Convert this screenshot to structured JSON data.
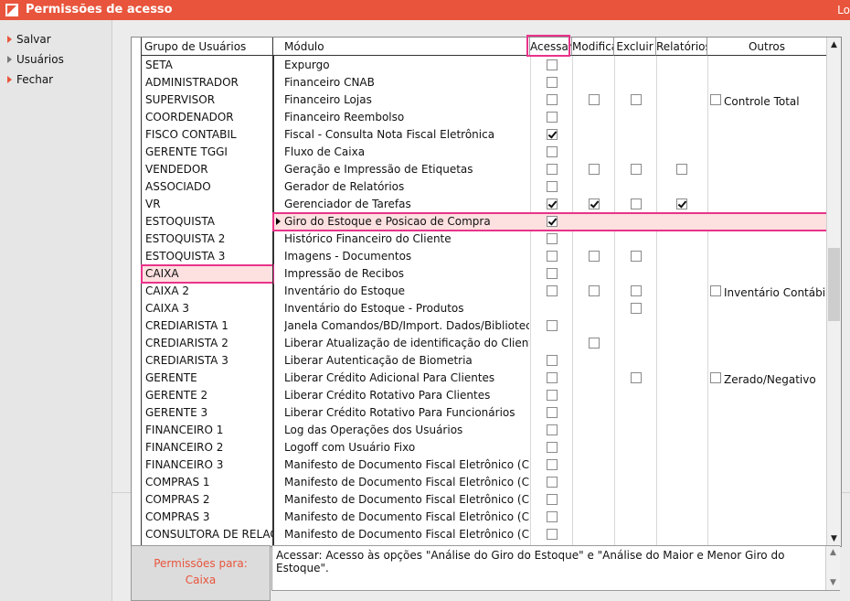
{
  "window": {
    "title": "Permissões de acesso",
    "right_text": "Lo"
  },
  "menu": [
    {
      "label": "Salvar",
      "icon": "arrow-right-icon"
    },
    {
      "label": "Usuários",
      "icon": "arrow-right-icon"
    },
    {
      "label": "Fechar",
      "icon": "arrow-right-icon"
    }
  ],
  "groups": {
    "header": "Grupo de Usuários",
    "selected": "CAIXA",
    "items": [
      "SETA",
      "ADMINISTRADOR",
      "SUPERVISOR",
      "COORDENADOR",
      "FISCO CONTABIL",
      "GERENTE TGGI",
      "VENDEDOR",
      "ASSOCIADO",
      "VR",
      "ESTOQUISTA",
      "ESTOQUISTA 2",
      "ESTOQUISTA 3",
      "CAIXA",
      "CAIXA 2",
      "CAIXA 3",
      "CREDIARISTA 1",
      "CREDIARISTA 2",
      "CREDIARISTA 3",
      "GERENTE",
      "GERENTE 2",
      "GERENTE 3",
      "FINANCEIRO 1",
      "FINANCEIRO 2",
      "FINANCEIRO 3",
      "COMPRAS 1",
      "COMPRAS 2",
      "COMPRAS 3",
      "CONSULTORA DE RELACIONAMENTO"
    ]
  },
  "modules": {
    "headers": [
      "Módulo",
      "Acessar",
      "Modifica",
      "Excluir",
      "Relatórios",
      "Outros"
    ],
    "selected_index": 9,
    "rows": [
      {
        "name": "Expurgo",
        "acessar": false
      },
      {
        "name": "Financeiro CNAB",
        "acessar": false
      },
      {
        "name": "Financeiro Lojas",
        "acessar": false,
        "modifica": false,
        "excluir": false,
        "other_label": "Controle Total",
        "other": false
      },
      {
        "name": "Financeiro Reembolso",
        "acessar": false
      },
      {
        "name": "Fiscal - Consulta Nota Fiscal Eletrônica",
        "acessar": true
      },
      {
        "name": "Fluxo de Caixa",
        "acessar": false
      },
      {
        "name": "Geração e Impressão de Etiquetas",
        "acessar": false,
        "modifica": false,
        "excluir": false,
        "relatorios": false
      },
      {
        "name": "Gerador de Relatórios",
        "acessar": false
      },
      {
        "name": "Gerenciador de Tarefas",
        "acessar": true,
        "modifica": true,
        "excluir": false,
        "relatorios": true
      },
      {
        "name": "Giro do Estoque e Posicao de Compra",
        "acessar": true
      },
      {
        "name": "Histórico Financeiro do Cliente",
        "acessar": false
      },
      {
        "name": "Imagens - Documentos",
        "acessar": false,
        "modifica": false,
        "excluir": false
      },
      {
        "name": "Impressão de Recibos",
        "acessar": false
      },
      {
        "name": "Inventário do Estoque",
        "acessar": false,
        "modifica": false,
        "excluir": false,
        "other_label": "Inventário Contábil",
        "other": false
      },
      {
        "name": "Inventário do Estoque - Produtos",
        "excluir": false
      },
      {
        "name": "Janela Comandos/BD/Import. Dados/Biblioteca de Funções",
        "acessar": false
      },
      {
        "name": "Liberar Atualização de identificação do Cliente",
        "modifica": false
      },
      {
        "name": "Liberar Autenticação de Biometria",
        "acessar": false
      },
      {
        "name": "Liberar Crédito Adicional Para Clientes",
        "acessar": false,
        "excluir": false,
        "other_label": "Zerado/Negativo",
        "other": false
      },
      {
        "name": "Liberar Crédito Rotativo Para Clientes",
        "acessar": false
      },
      {
        "name": "Liberar Crédito Rotativo Para Funcionários",
        "acessar": false
      },
      {
        "name": "Log das Operações dos Usuários",
        "acessar": false
      },
      {
        "name": "Logoff com Usuário Fixo",
        "acessar": false
      },
      {
        "name": "Manifesto de Documento Fiscal Eletrônico (Configurações)",
        "acessar": false
      },
      {
        "name": "Manifesto de Documento Fiscal Eletrônico (Configurações)",
        "acessar": false
      },
      {
        "name": "Manifesto de Documento Fiscal Eletrônico (Configurações)",
        "acessar": false
      },
      {
        "name": "Manifesto de Documento Fiscal Eletrônico (Configurações)",
        "acessar": false
      },
      {
        "name": "Manifesto de Documento Fiscal Eletrônico (Configurações)",
        "acessar": false
      }
    ]
  },
  "footer": {
    "permissions_label": "Permissões para:",
    "permissions_group": "Caixa",
    "description": "Acessar: Acesso às opções \"Análise do Giro do Estoque\" e \"Análise do Maior e Menor Giro do Estoque\"."
  }
}
